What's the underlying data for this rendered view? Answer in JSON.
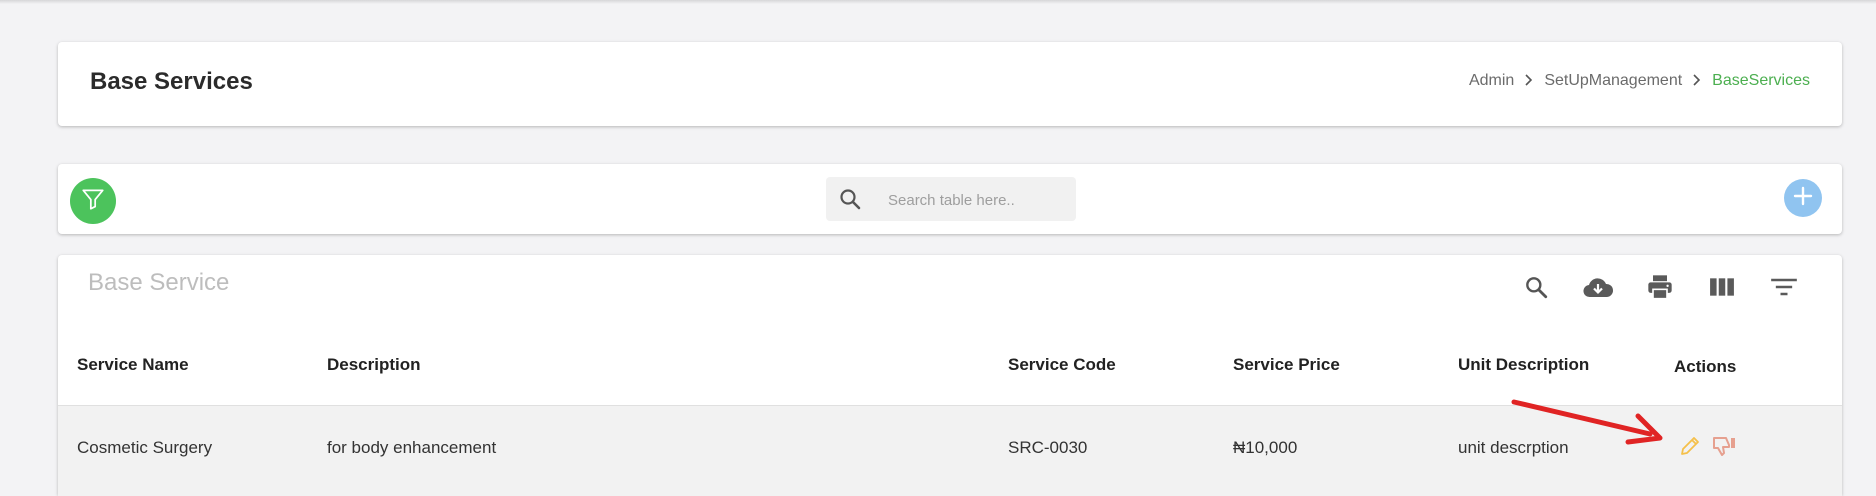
{
  "header": {
    "title": "Base Services",
    "breadcrumb": [
      "Admin",
      "SetUpManagement",
      "BaseServices"
    ]
  },
  "toolbar": {
    "search_placeholder": "Search table here..",
    "filter_icon": "filter-icon",
    "add_icon": "plus-icon"
  },
  "table": {
    "title": "Base Service",
    "columns": [
      "Service Name",
      "Description",
      "Service Code",
      "Service Price",
      "Unit Description",
      "Actions"
    ],
    "rows": [
      {
        "service_name": "Cosmetic Surgery",
        "description": "for body enhancement",
        "service_code": "SRC-0030",
        "service_price": "₦10,000",
        "unit_description": "unit descrption"
      }
    ],
    "tools": [
      "search-icon",
      "cloud-download-icon",
      "print-icon",
      "view-column-icon",
      "filter-list-icon"
    ]
  },
  "colors": {
    "accent_green": "#4cc35c",
    "breadcrumb_active": "#4caf50",
    "add_button": "#90c4f0",
    "edit_icon": "#f5c04a",
    "dislike_icon": "#e6a08f",
    "annotation_arrow": "#e02424"
  }
}
